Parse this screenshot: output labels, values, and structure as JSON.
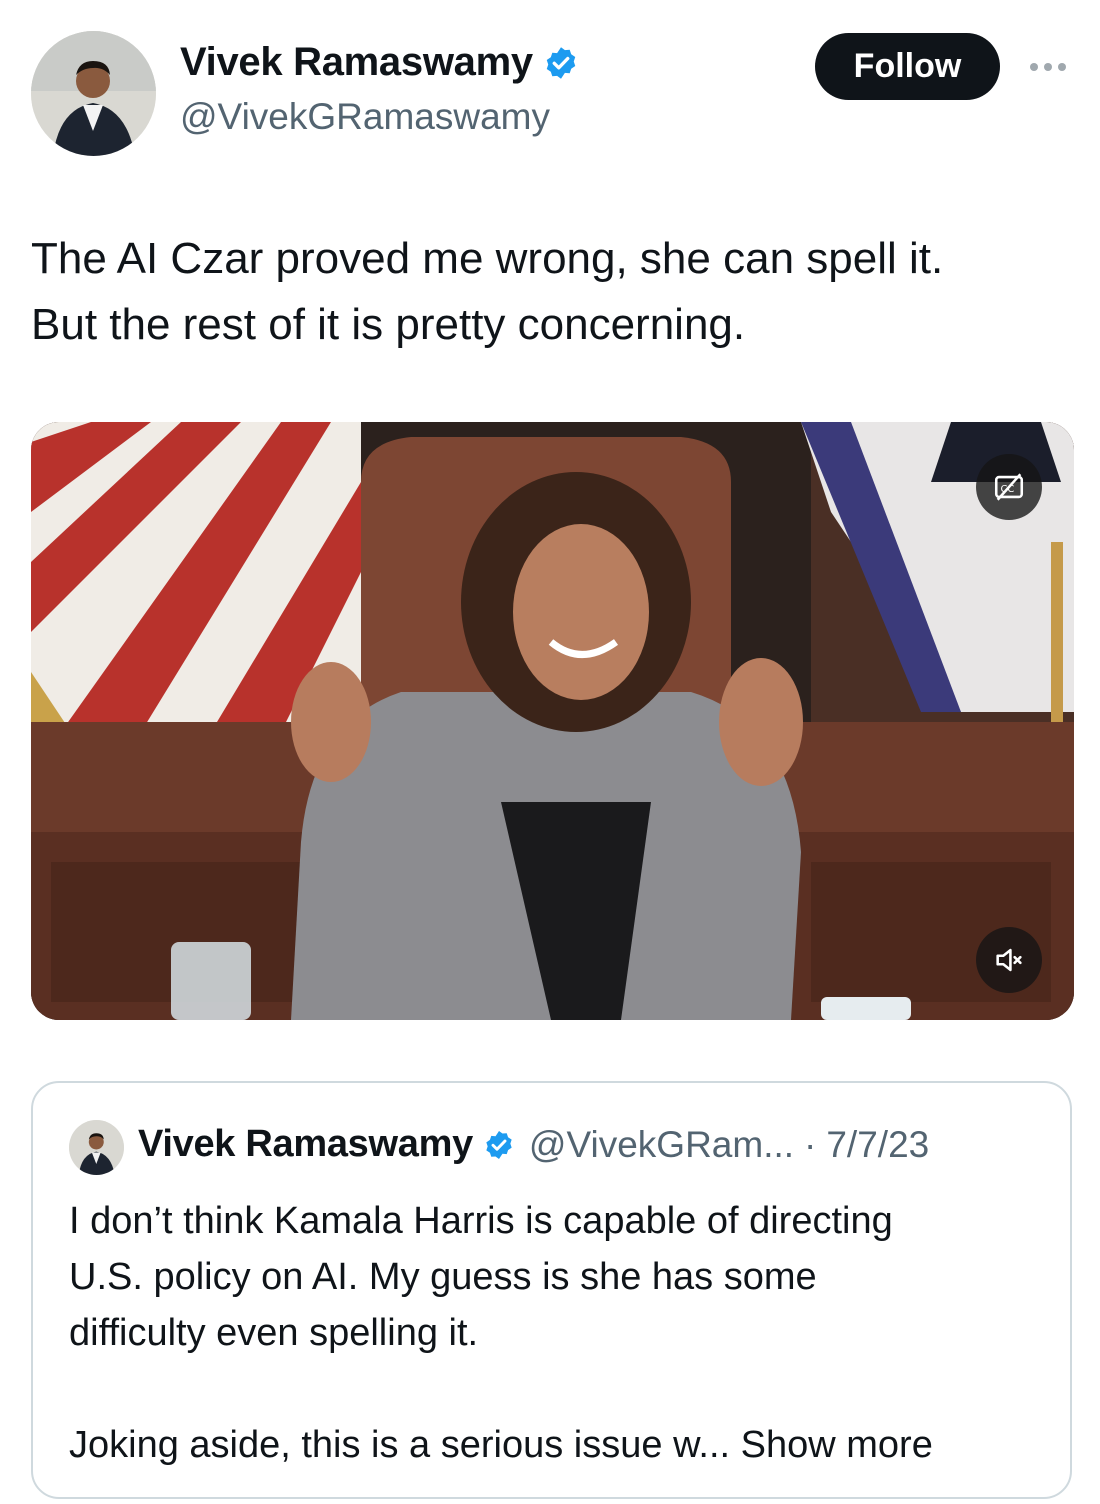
{
  "author": {
    "name": "Vivek Ramaswamy",
    "handle": "@VivekGRamaswamy",
    "verified": true
  },
  "actions": {
    "follow_label": "Follow",
    "more_icon": "more-horizontal-icon"
  },
  "tweet": {
    "text_lines": [
      "The AI Czar proved me wrong, she can spell it.",
      "But the rest of it is pretty concerning."
    ]
  },
  "media": {
    "type": "video",
    "captions_icon": "captions-off-icon",
    "mute_icon": "volume-muted-icon"
  },
  "quoted": {
    "author_name": "Vivek Ramaswamy",
    "handle_truncated": "@VivekGRam...",
    "separator": "·",
    "date": "7/7/23",
    "text_lines": [
      "I don’t think Kamala Harris is capable of directing",
      "U.S. policy on AI. My guess is she has some",
      "difficulty even spelling it."
    ],
    "text_tail": "Joking aside, this is a serious issue w...",
    "show_more_label": "Show more"
  },
  "colors": {
    "text": "#0f1419",
    "secondary": "#536471",
    "verified": "#1d9bf0",
    "border": "#cfd9de"
  }
}
